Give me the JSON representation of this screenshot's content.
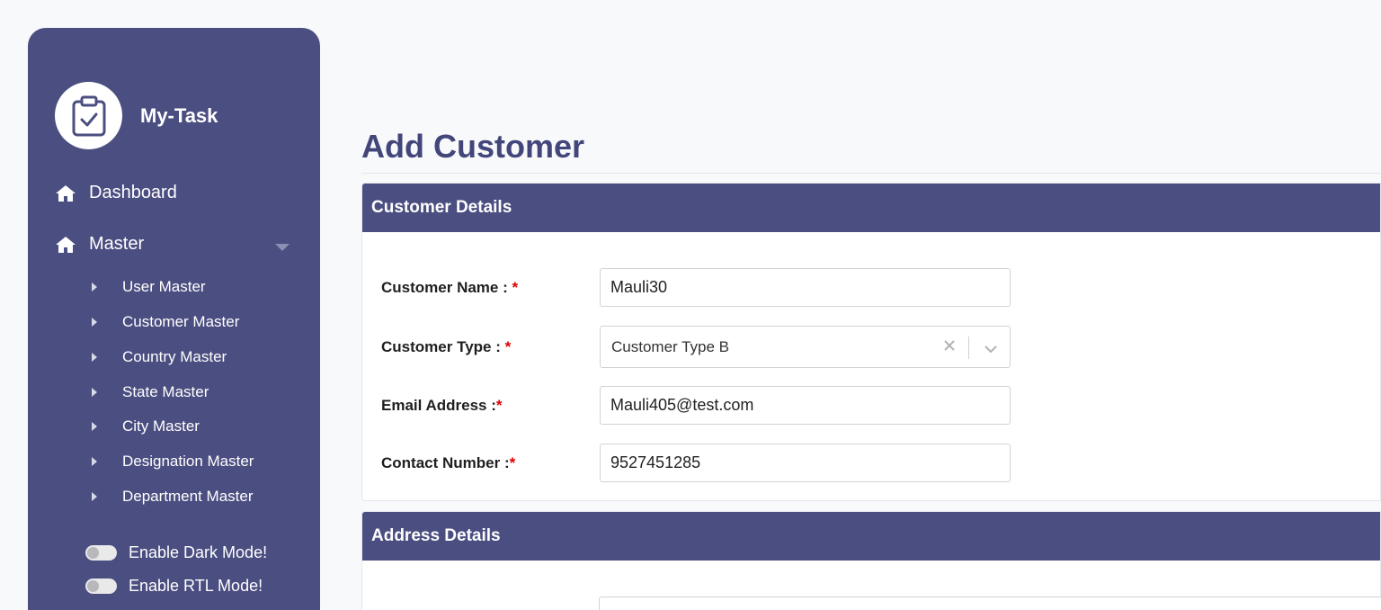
{
  "sidebar": {
    "brand": "My-Task",
    "nav": [
      {
        "label": "Dashboard",
        "icon": "home-icon"
      },
      {
        "label": "Master",
        "icon": "home-icon"
      }
    ],
    "master_items": [
      {
        "label": "User Master"
      },
      {
        "label": "Customer Master"
      },
      {
        "label": "Country Master"
      },
      {
        "label": "State Master"
      },
      {
        "label": "City Master"
      },
      {
        "label": "Designation Master"
      },
      {
        "label": "Department Master"
      }
    ],
    "toggles": [
      {
        "label": "Enable Dark Mode!",
        "on": false
      },
      {
        "label": "Enable RTL Mode!",
        "on": false
      }
    ]
  },
  "main": {
    "title": "Add Customer",
    "customer_details": {
      "header": "Customer Details",
      "fields": {
        "name": {
          "label": "Customer Name :",
          "value": "Mauli30"
        },
        "type": {
          "label": "Customer Type :",
          "value": "Customer Type B"
        },
        "email": {
          "label": "Email Address :",
          "value": "Mauli405@test.com"
        },
        "contact": {
          "label": "Contact Number :",
          "value": "9527451285"
        }
      },
      "required_marker": "*"
    },
    "address_details": {
      "header": "Address Details"
    }
  },
  "colors": {
    "sidebar_bg": "#4b4e80",
    "header_bg": "#4b4e80",
    "title_color": "#43467a",
    "required": "#dd0000"
  }
}
